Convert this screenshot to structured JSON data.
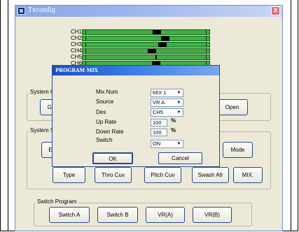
{
  "window": {
    "title": "Txconfig",
    "close_label": "X"
  },
  "channels": [
    {
      "label": "CH1",
      "knob": 0.44
    },
    {
      "label": "CH2",
      "knob": 0.6
    },
    {
      "label": "CH3",
      "knob": 0.55
    },
    {
      "label": "CH4",
      "knob": 0.39
    },
    {
      "label": "CH5",
      "knob": 0.5
    },
    {
      "label": "CH6",
      "knob": 0.43
    }
  ],
  "groups": {
    "system_config": "System C",
    "system_setup": "System S",
    "switch_program": "Switch Program"
  },
  "buttons": {
    "getu": "GetU",
    "open": "Open",
    "endp": "EndP",
    "mode": "Mode",
    "type": "Type",
    "thro_cuv": "Thro Cuv",
    "pitch_cuv": "Pitch Cuv",
    "swash_afr": "Swash Afr",
    "mix": "MIX."
  },
  "switch_program": {
    "buttons": [
      "Switch A",
      "Switch B",
      "VR(A)",
      "VR(B)"
    ]
  },
  "dialog": {
    "title": "PROGRAM MIX",
    "labels": {
      "mix_num": "Mix Num",
      "source": "Source",
      "des": "Des",
      "up_rate": "Up Rate",
      "down_rate": "Down Rate",
      "switch": "Switch"
    },
    "values": {
      "mix_num": "MIX 1",
      "source": "VR A",
      "des": "CH5",
      "up_rate": "100",
      "down_rate": "100",
      "switch": "ON"
    },
    "unit": "%",
    "ok": "OK",
    "cancel": "Cancel"
  }
}
